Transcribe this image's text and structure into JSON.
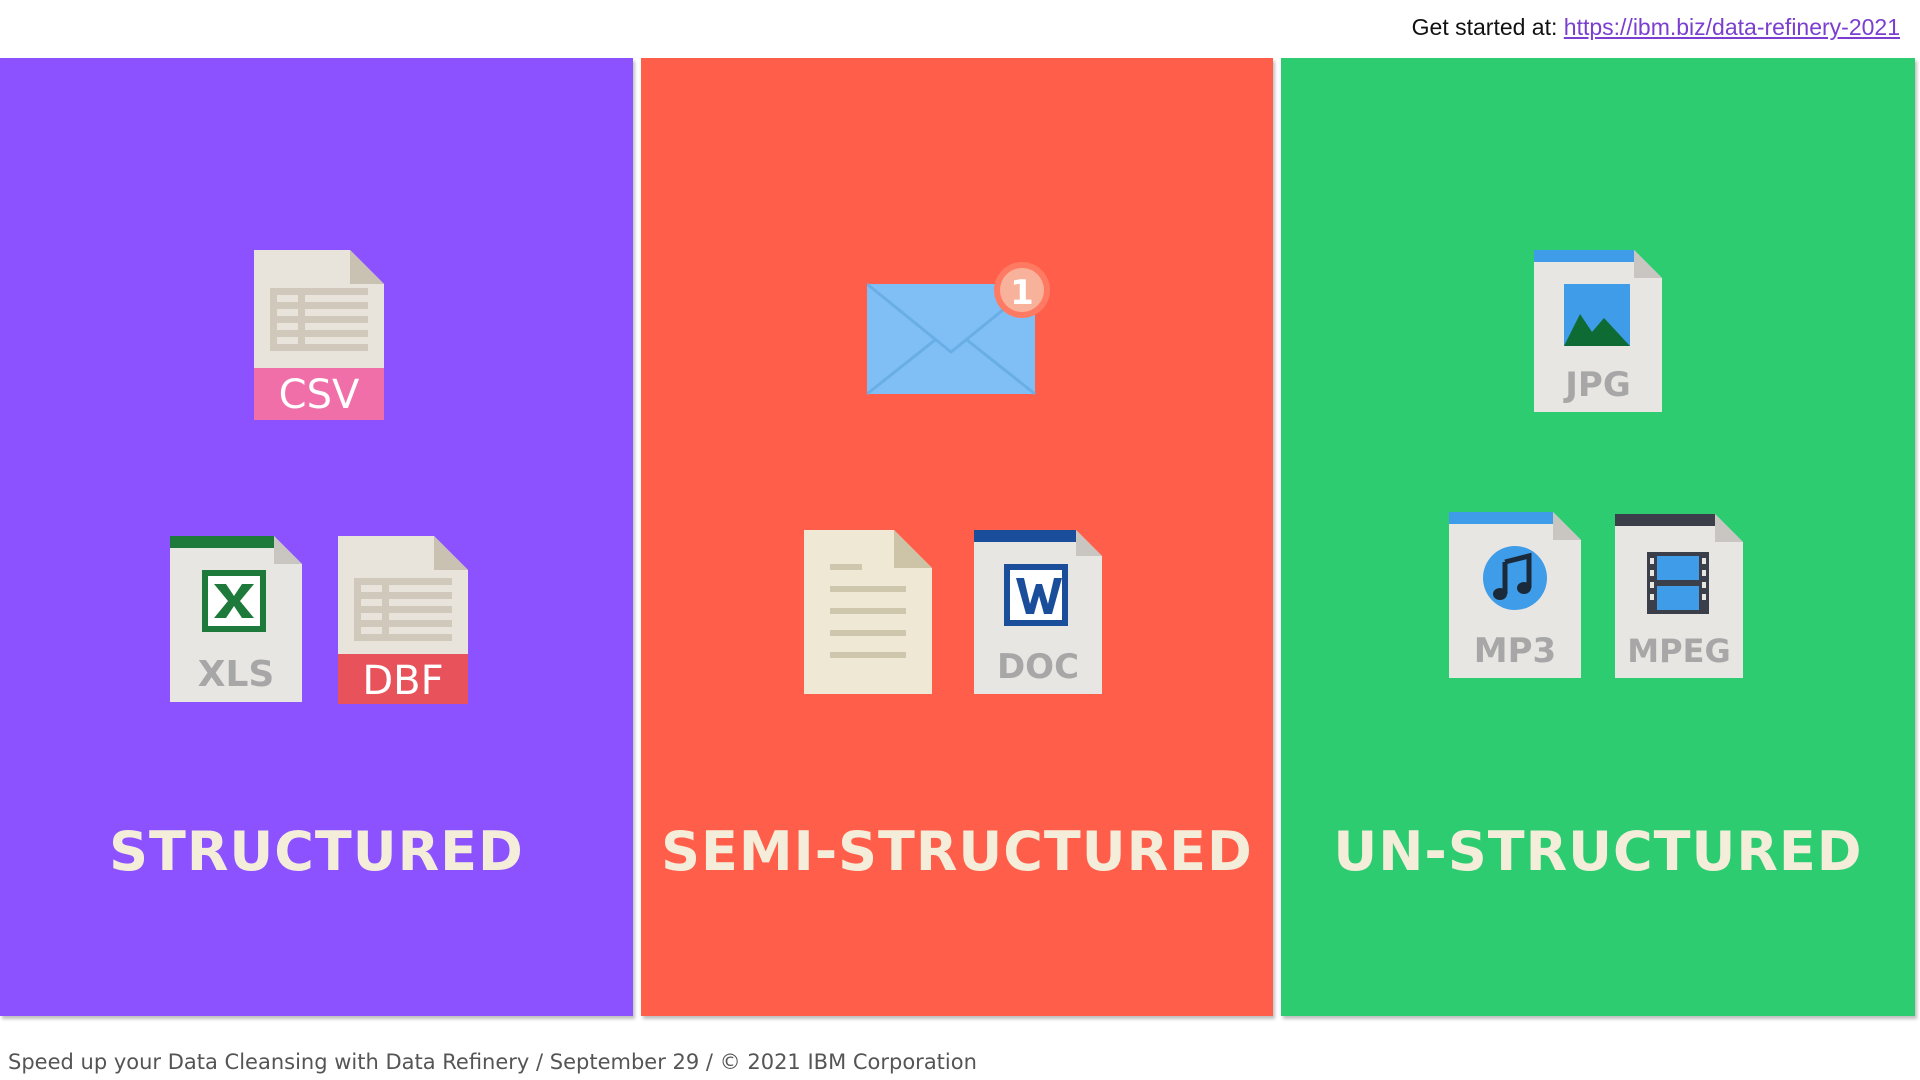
{
  "header": {
    "label": "Get started at:",
    "link_text": "https://ibm.biz/data-refinery-2021"
  },
  "panels": [
    {
      "title": "STRUCTURED",
      "color": "#8c52ff",
      "files": [
        {
          "icon": "csv-file-icon",
          "label": "CSV",
          "accent": "#f06fa8"
        },
        {
          "icon": "xls-file-icon",
          "label": "XLS",
          "accent": "#1d7a3a"
        },
        {
          "icon": "dbf-file-icon",
          "label": "DBF",
          "accent": "#e8525a"
        }
      ]
    },
    {
      "title": "SEMI-STRUCTURED",
      "color": "#ff5f4a",
      "files": [
        {
          "icon": "envelope-icon",
          "badge": "1",
          "accent": "#80bff5"
        },
        {
          "icon": "text-document-icon",
          "accent": "#efe8d5"
        },
        {
          "icon": "doc-file-icon",
          "label": "DOC",
          "accent": "#1a4d9a"
        }
      ]
    },
    {
      "title": "UN-STRUCTURED",
      "color": "#2ecc71",
      "files": [
        {
          "icon": "jpg-file-icon",
          "label": "JPG",
          "accent": "#3e9ce8"
        },
        {
          "icon": "mp3-file-icon",
          "label": "MP3",
          "accent": "#3e9ce8"
        },
        {
          "icon": "mpeg-file-icon",
          "label": "MPEG",
          "accent": "#3a3f4a"
        }
      ]
    }
  ],
  "footer": {
    "text": "Speed up your Data Cleansing with Data Refinery / September 29 / © 2021 IBM Corporation"
  }
}
